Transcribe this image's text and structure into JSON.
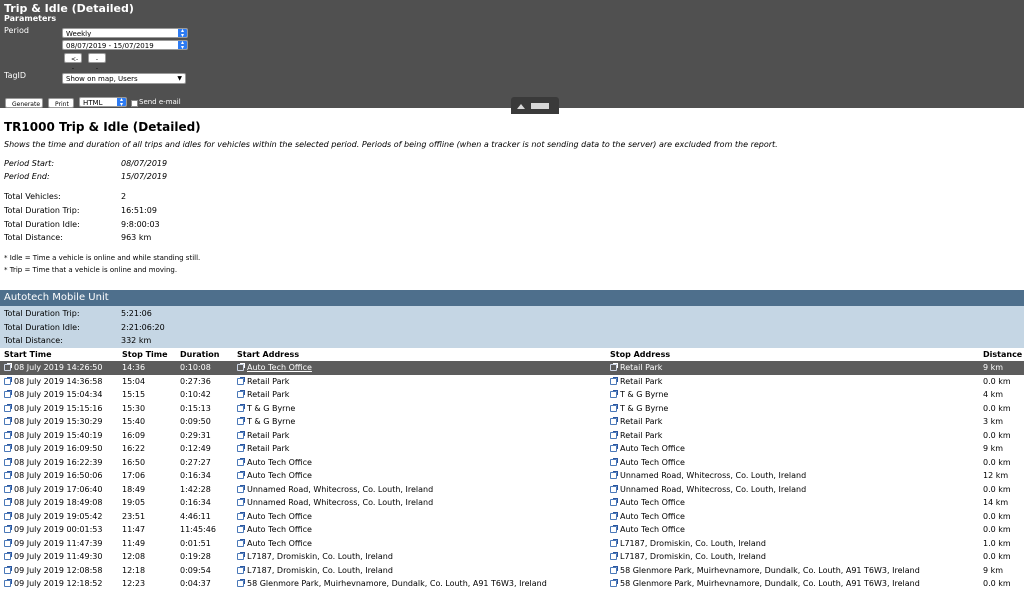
{
  "panel": {
    "title": "Trip & Idle (Detailed)",
    "subtitle": "Parameters",
    "period_label": "Period",
    "period_value": "Weekly",
    "date_range": "08/07/2019 - 15/07/2019",
    "prev_label": "<--",
    "next_label": "-->",
    "tagid_label": "TagID",
    "tagid_value": "Show on map, Users",
    "generate_label": "Generate",
    "print_label": "Print",
    "format_value": "HTML",
    "email_label": "Send e-mail"
  },
  "report": {
    "title": "TR1000 Trip & Idle (Detailed)",
    "description": "Shows the time and duration of all trips and idles for vehicles within the selected period. Periods of being offline (when a tracker is not sending data to the server) are excluded from the report.",
    "period_start_label": "Period Start:",
    "period_start": "08/07/2019",
    "period_end_label": "Period End:",
    "period_end": "15/07/2019",
    "total_vehicles_label": "Total Vehicles:",
    "total_vehicles": "2",
    "total_trip_label": "Total Duration Trip:",
    "total_trip": "16:51:09",
    "total_idle_label": "Total Duration Idle:",
    "total_idle": "9:8:00:03",
    "total_distance_label": "Total Distance:",
    "total_distance": "963 km",
    "note_idle": "* Idle = Time a vehicle is online and while standing still.",
    "note_trip": "* Trip = Time that a vehicle is online and moving."
  },
  "unit": {
    "name": "Autotech Mobile Unit",
    "trip_label": "Total Duration Trip:",
    "trip": "5:21:06",
    "idle_label": "Total Duration Idle:",
    "idle": "2:21:06:20",
    "distance_label": "Total Distance:",
    "distance": "332 km"
  },
  "table": {
    "headers": [
      "Start Time",
      "Stop Time",
      "Duration",
      "Start Address",
      "Stop Address",
      "Distance"
    ],
    "rows": [
      [
        "08 July 2019 14:26:50",
        "14:36",
        "0:10:08",
        "Auto Tech Office",
        "Retail Park",
        "9 km"
      ],
      [
        "08 July 2019 14:36:58",
        "15:04",
        "0:27:36",
        "Retail Park",
        "Retail Park",
        "0.0 km"
      ],
      [
        "08 July 2019 15:04:34",
        "15:15",
        "0:10:42",
        "Retail Park",
        "T & G Byrne",
        "4 km"
      ],
      [
        "08 July 2019 15:15:16",
        "15:30",
        "0:15:13",
        "T & G Byrne",
        "T & G Byrne",
        "0.0 km"
      ],
      [
        "08 July 2019 15:30:29",
        "15:40",
        "0:09:50",
        "T & G Byrne",
        "Retail Park",
        "3 km"
      ],
      [
        "08 July 2019 15:40:19",
        "16:09",
        "0:29:31",
        "Retail Park",
        "Retail Park",
        "0.0 km"
      ],
      [
        "08 July 2019 16:09:50",
        "16:22",
        "0:12:49",
        "Retail Park",
        "Auto Tech Office",
        "9 km"
      ],
      [
        "08 July 2019 16:22:39",
        "16:50",
        "0:27:27",
        "Auto Tech Office",
        "Auto Tech Office",
        "0.0 km"
      ],
      [
        "08 July 2019 16:50:06",
        "17:06",
        "0:16:34",
        "Auto Tech Office",
        "Unnamed Road, Whitecross, Co. Louth, Ireland",
        "12 km"
      ],
      [
        "08 July 2019 17:06:40",
        "18:49",
        "1:42:28",
        "Unnamed Road, Whitecross, Co. Louth, Ireland",
        "Unnamed Road, Whitecross, Co. Louth, Ireland",
        "0.0 km"
      ],
      [
        "08 July 2019 18:49:08",
        "19:05",
        "0:16:34",
        "Unnamed Road, Whitecross, Co. Louth, Ireland",
        "Auto Tech Office",
        "14 km"
      ],
      [
        "08 July 2019 19:05:42",
        "23:51",
        "4:46:11",
        "Auto Tech Office",
        "Auto Tech Office",
        "0.0 km"
      ],
      [
        "09 July 2019 00:01:53",
        "11:47",
        "11:45:46",
        "Auto Tech Office",
        "Auto Tech Office",
        "0.0 km"
      ],
      [
        "09 July 2019 11:47:39",
        "11:49",
        "0:01:51",
        "Auto Tech Office",
        "L7187, Dromiskin, Co. Louth, Ireland",
        "1.0 km"
      ],
      [
        "09 July 2019 11:49:30",
        "12:08",
        "0:19:28",
        "L7187, Dromiskin, Co. Louth, Ireland",
        "L7187, Dromiskin, Co. Louth, Ireland",
        "0.0 km"
      ],
      [
        "09 July 2019 12:08:58",
        "12:18",
        "0:09:54",
        "L7187, Dromiskin, Co. Louth, Ireland",
        "58 Glenmore Park, Muirhevnamore, Dundalk, Co. Louth, A91 T6W3, Ireland",
        "9 km"
      ],
      [
        "09 July 2019 12:18:52",
        "12:23",
        "0:04:37",
        "58 Glenmore Park, Muirhevnamore, Dundalk, Co. Louth, A91 T6W3, Ireland",
        "58 Glenmore Park, Muirhevnamore, Dundalk, Co. Louth, A91 T6W3, Ireland",
        "0.0 km"
      ]
    ]
  }
}
